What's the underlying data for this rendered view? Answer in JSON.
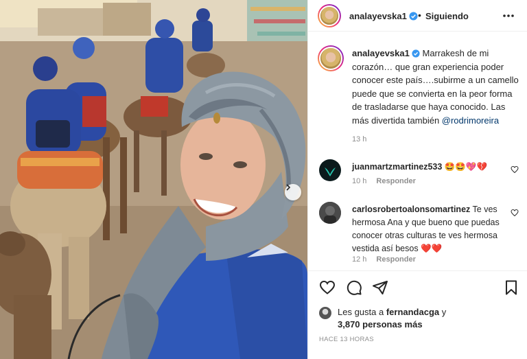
{
  "post": {
    "author": "analayevska1",
    "follow_separator": "•",
    "follow_label": "Siguiendo",
    "more_icon": "more-horizontal-icon",
    "photo_alt": "Mujer con turbante gris sonriendo sobre un camello en Marrakesh"
  },
  "caption": {
    "username": "analayevska1",
    "text_before_mention": "Marrakesh de mi corazón… que gran experiencia poder conocer este país….subirme a un camello puede que se convierta en la peor forma de trasladarse que haya conocido. Las más divertida también ",
    "mention": "@rodrimoreira",
    "time": "13 h"
  },
  "comments": [
    {
      "username": "juanmartzmartinez533",
      "text": "🤩🤩💖💔",
      "time": "10 h",
      "reply_label": "Responder"
    },
    {
      "username": "carlosrobertoalonsomartinez",
      "text": "Te ves hermosa Ana y que bueno que puedas conocer otras culturas te ves hermosa vestida así besos ❤️❤️",
      "time": "12 h",
      "reply_label": "Responder"
    }
  ],
  "likes": {
    "prefix": "Les gusta a ",
    "user": "fernandacga",
    "suffix": " y",
    "count_line": "3,870 personas más"
  },
  "posted_label": "HACE 13 HORAS",
  "colors": {
    "verified": "#3897f0",
    "link": "#00376b",
    "muted": "#8e8e8e",
    "heart_red": "#ed4956"
  }
}
